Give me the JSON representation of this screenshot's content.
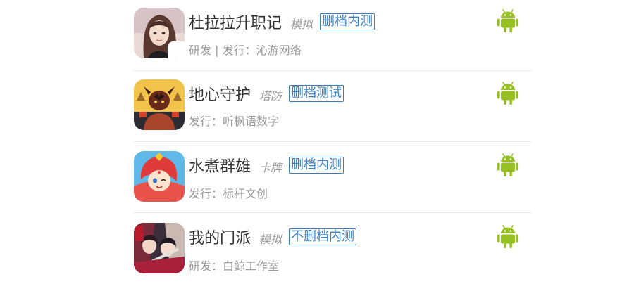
{
  "accent_colors": {
    "tag": "#3a7fc1",
    "android": "#97c024",
    "muted_text": "#9a9a9a",
    "title_text": "#333333"
  },
  "games": [
    {
      "name": "杜拉拉升职记",
      "genre": "模拟",
      "status": "删档内测",
      "meta": "研发 | 发行：沁游网络",
      "platform_icon": "android-icon"
    },
    {
      "name": "地心守护",
      "genre": "塔防",
      "status": "删档测试",
      "meta": "发行：听枫语数字",
      "platform_icon": "android-icon"
    },
    {
      "name": "水煮群雄",
      "genre": "卡牌",
      "status": "删档内测",
      "meta": "发行：标杆文创",
      "platform_icon": "android-icon"
    },
    {
      "name": "我的门派",
      "genre": "模拟",
      "status": "不删档内测",
      "meta": "研发：白鲸工作室",
      "platform_icon": "android-icon"
    }
  ]
}
